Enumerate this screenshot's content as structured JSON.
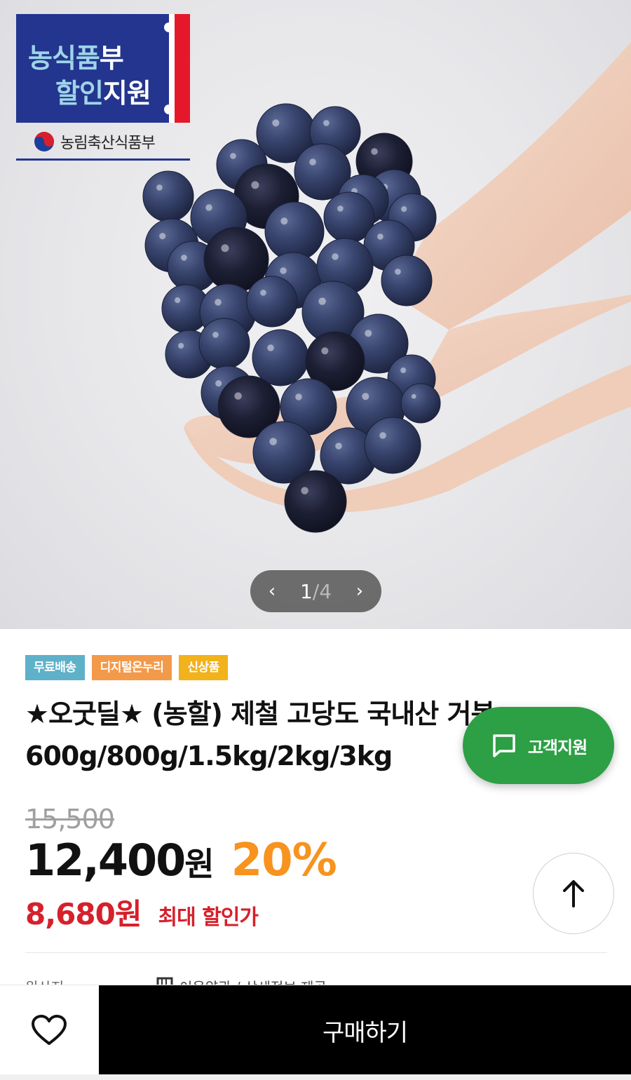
{
  "certification": {
    "line1_a": "농식품",
    "line1_b": "부",
    "line2_a": "할인",
    "line2_b": "지원",
    "ministry": "농림축산식품부"
  },
  "pager": {
    "current": "1",
    "separator": "/",
    "total": "4",
    "prev_icon": "chevron-left-icon",
    "next_icon": "chevron-right-icon"
  },
  "badges": [
    {
      "label": "무료배송",
      "color": "#5eb1c9"
    },
    {
      "label": "디지털온누리",
      "color": "#f39a4a"
    },
    {
      "label": "신상품",
      "color": "#f2b21b"
    }
  ],
  "product": {
    "title_line1": "★오굿딜★ (농할) 제철 고당도 국내산 거봉",
    "title_line2": "600g/800g/1.5kg/2kg/3kg"
  },
  "support": {
    "label": "고객지원",
    "icon": "chat-bubble-icon",
    "color": "#2d9f45"
  },
  "pricing": {
    "original": "15,500",
    "price": "12,400",
    "price_unit": "원",
    "discount": "20%",
    "max_price": "8,680원",
    "max_label": "최대 할인가"
  },
  "scroll_top": {
    "icon": "arrow-up-icon"
  },
  "partial_row": {
    "left": "원산지",
    "right": "이용약관 / 상세정보 제공"
  },
  "bottom_bar": {
    "buy_label": "구매하기",
    "wish_icon": "heart-icon"
  }
}
